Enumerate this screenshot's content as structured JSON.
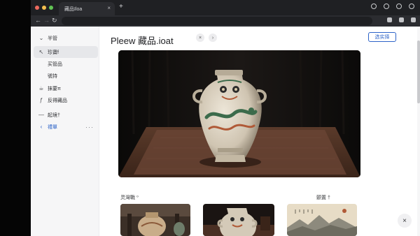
{
  "browser": {
    "tab_title": "藏品Iloa",
    "tab_close": "×",
    "new_tab": "+",
    "traffic_colors": [
      "#ed6a5e",
      "#f5bf4f",
      "#61c454"
    ]
  },
  "sidebar": {
    "heading": "半管",
    "items": [
      {
        "icon": "arrow-cursor-icon",
        "glyph": "↖",
        "label": "珍寶f",
        "active": true
      },
      {
        "icon": "",
        "glyph": "",
        "label": "买管品",
        "active": false
      },
      {
        "icon": "",
        "glyph": "",
        "label": "號持",
        "active": false
      },
      {
        "icon": "teapot-icon",
        "glyph": "☕",
        "label": "抹要π",
        "active": false
      },
      {
        "icon": "spark-icon",
        "glyph": "ƒ",
        "label": "反得藏品",
        "active": false
      },
      {
        "icon": "",
        "glyph": "",
        "label": "",
        "active": false
      },
      {
        "icon": "dash-icon",
        "glyph": "—",
        "label": "起境†",
        "active": false
      },
      {
        "icon": "back-arrow-icon",
        "glyph": "‹",
        "label": "禮單",
        "active": false,
        "link": true
      }
    ],
    "more": "···"
  },
  "main": {
    "title": "Pleew 藏品.ioat",
    "title_chip_1": "×",
    "title_chip_2": "›",
    "select_button": "选实择",
    "section_left": "灵灣戰 ⁰",
    "section_right": "颤置 †",
    "close_fab": "×"
  },
  "colors": {
    "accent": "#2d63c8",
    "jar_body": "#d9d0c0",
    "dragon_green": "#3c6b4b",
    "rust": "#b05a37"
  }
}
